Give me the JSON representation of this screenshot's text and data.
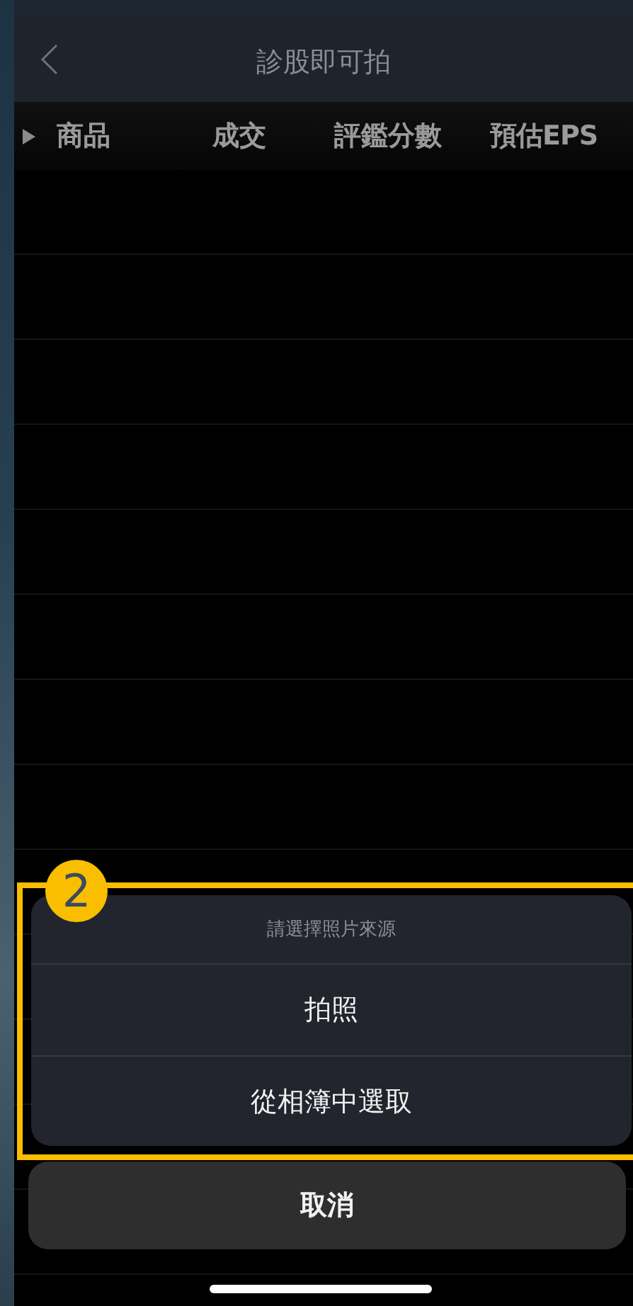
{
  "nav_bar": {
    "title": "診股即可拍"
  },
  "table": {
    "columns": [
      "商品",
      "成交",
      "評鑑分數",
      "預估EPS"
    ]
  },
  "action_sheet": {
    "step_badge": "2",
    "title": "請選擇照片來源",
    "options": [
      "拍照",
      "從相簿中選取"
    ],
    "cancel": "取消"
  }
}
